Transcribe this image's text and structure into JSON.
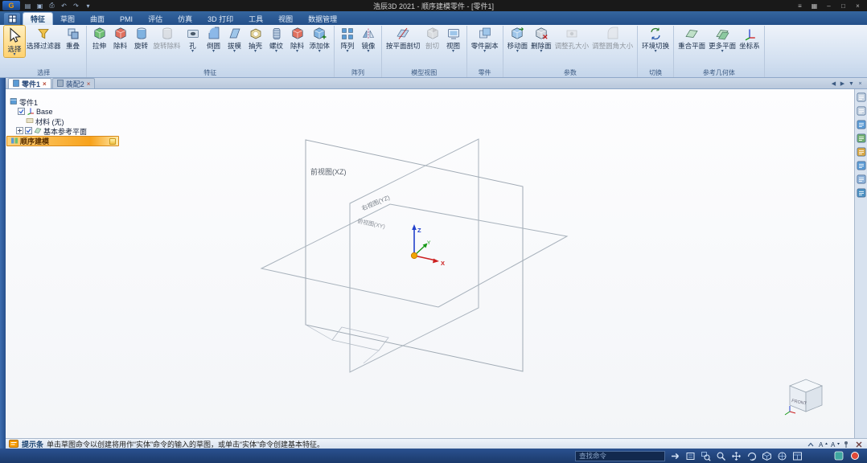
{
  "titlebar": {
    "title": "浩辰3D 2021 - 顺序建模零件 - [零件1]",
    "qat_icons": [
      "menu-grid-icon",
      "save-icon",
      "print-icon",
      "undo-icon",
      "redo-icon",
      "customize-quick-access-icon"
    ],
    "qat_glyphs": [
      "▤",
      "▣",
      "⎙",
      "↶",
      "↷",
      "▾"
    ],
    "window_icons": [
      "ribbon-display-icon",
      "window-style-icon",
      "minimize-icon",
      "restore-icon",
      "close-icon"
    ],
    "window_glyphs": [
      "≡",
      "▦",
      "–",
      "□",
      "×"
    ]
  },
  "ribbon_tabs": [
    {
      "label": "特征",
      "active": true
    },
    {
      "label": "草图"
    },
    {
      "label": "曲面"
    },
    {
      "label": "PMI"
    },
    {
      "label": "评估"
    },
    {
      "label": "仿真"
    },
    {
      "label": "3D 打印"
    },
    {
      "label": "工具"
    },
    {
      "label": "视图"
    },
    {
      "label": "数据管理"
    }
  ],
  "ribbon_groups": [
    {
      "label": "选择",
      "buttons": [
        {
          "label": "选择",
          "icon": "cursor",
          "big": true,
          "arrow": true,
          "selected": true
        },
        {
          "label": "选择过滤器",
          "icon": "funnel"
        },
        {
          "label": "重叠",
          "icon": "overlap"
        }
      ]
    },
    {
      "label": "特征",
      "buttons": [
        {
          "label": "拉伸",
          "icon": "extrude"
        },
        {
          "label": "除料",
          "icon": "cut"
        },
        {
          "label": "旋转",
          "icon": "revolve"
        },
        {
          "label": "旋转除料",
          "icon": "revolve-cut",
          "disabled": true
        },
        {
          "label": "孔",
          "icon": "hole",
          "arrow": true
        },
        {
          "label": "倒圆",
          "icon": "round",
          "arrow": true
        },
        {
          "label": "拔模",
          "icon": "draft",
          "arrow": true
        },
        {
          "label": "抽壳",
          "icon": "shell",
          "arrow": true
        },
        {
          "label": "螺纹",
          "icon": "thread",
          "arrow": true
        },
        {
          "label": "除料",
          "icon": "cut2",
          "arrow": true
        },
        {
          "label": "添加体",
          "icon": "add-body",
          "arrow": true
        }
      ]
    },
    {
      "label": "阵列",
      "buttons": [
        {
          "label": "阵列",
          "icon": "pattern",
          "arrow": true
        },
        {
          "label": "镜像",
          "icon": "mirror",
          "arrow": true
        }
      ]
    },
    {
      "label": "模型视图",
      "buttons": [
        {
          "label": "按平面剖切",
          "icon": "section"
        },
        {
          "label": "剖切",
          "icon": "cutaway",
          "disabled": true
        },
        {
          "label": "视图",
          "icon": "view",
          "arrow": true
        }
      ]
    },
    {
      "label": "零件",
      "buttons": [
        {
          "label": "零件副本",
          "icon": "part-copy",
          "arrow": true
        }
      ]
    },
    {
      "label": "参数",
      "buttons": [
        {
          "label": "移动面",
          "icon": "move-face",
          "arrow": true
        },
        {
          "label": "删除面",
          "icon": "delete-face",
          "arrow": true
        },
        {
          "label": "调整孔大小",
          "icon": "resize-hole",
          "disabled": true
        },
        {
          "label": "调整圆角大小",
          "icon": "resize-round",
          "disabled": true
        }
      ]
    },
    {
      "label": "切换",
      "buttons": [
        {
          "label": "环境切换",
          "icon": "env-switch",
          "arrow": true
        }
      ]
    },
    {
      "label": "参考几何体",
      "buttons": [
        {
          "label": "重合平面",
          "icon": "plane"
        },
        {
          "label": "更多平面",
          "icon": "planes",
          "arrow": true
        },
        {
          "label": "坐标系",
          "icon": "csys"
        }
      ]
    }
  ],
  "doc_tabs": [
    {
      "label": "零件1",
      "active": true
    },
    {
      "label": "装配2"
    }
  ],
  "tab_control_glyphs": [
    "◀",
    "▶",
    "▼",
    "×"
  ],
  "tab_control_names": [
    "prev-tab-icon",
    "next-tab-icon",
    "tab-list-icon",
    "close-tab-icon"
  ],
  "tree": [
    {
      "label": "零件1",
      "level": 0,
      "icon": "part-root"
    },
    {
      "label": "Base",
      "level": 1,
      "icon": "base-csys",
      "checkbox": true,
      "checked": true
    },
    {
      "label": "材料 (无)",
      "level": 2,
      "icon": "material"
    },
    {
      "label": "基本参考平面",
      "level": 1,
      "icon": "ref-planes",
      "checkbox": true,
      "checked": true,
      "expander": true
    },
    {
      "label": "顺序建模",
      "level": 0,
      "icon": "ordered-modeling",
      "highlight": true
    }
  ],
  "viewport": {
    "plane_labels": [
      {
        "text": "前视图(XZ)"
      },
      {
        "text": "右视图(YZ)"
      },
      {
        "text": "俯视图(XY)"
      }
    ],
    "axis_labels": {
      "x": "X",
      "y": "Y",
      "z": "Z"
    },
    "view_cube": {
      "front_label": "FRONT"
    },
    "colors": {
      "x_axis": "#cc2020",
      "y_axis": "#169a16",
      "z_axis": "#2240cc",
      "origin": "#f0a500",
      "plane_edge": "#a8b2bc"
    }
  },
  "status_bar": {
    "label": "提示条",
    "message": "单击草图命令以创建将用作“实体”命令的输入的草图，或单击“实体”命令创建基本特征。",
    "right_icons": [
      "expand-prompt-icon",
      "font-increase-icon",
      "font-decrease-icon",
      "pin-icon",
      "close-prompt-icon"
    ]
  },
  "bottom_bar": {
    "search_placeholder": "查找命令",
    "icons": [
      "go-arrow-icon",
      "fit-view-icon",
      "zoom-area-icon",
      "zoom-icon",
      "pan-icon",
      "rotate-view-icon",
      "common-views-icon",
      "view-styles-icon",
      "window-layout-icon"
    ],
    "corner_icons": [
      "status-indicator-icon",
      "alert-dot-icon"
    ]
  },
  "right_strip_icons": [
    "dock-menu-icon",
    "prompt-bar-icon",
    "pathfinder-panel-icon",
    "library-panel-icon",
    "layers-panel-icon",
    "sensors-panel-icon",
    "variables-panel-icon",
    "web-panel-icon"
  ]
}
